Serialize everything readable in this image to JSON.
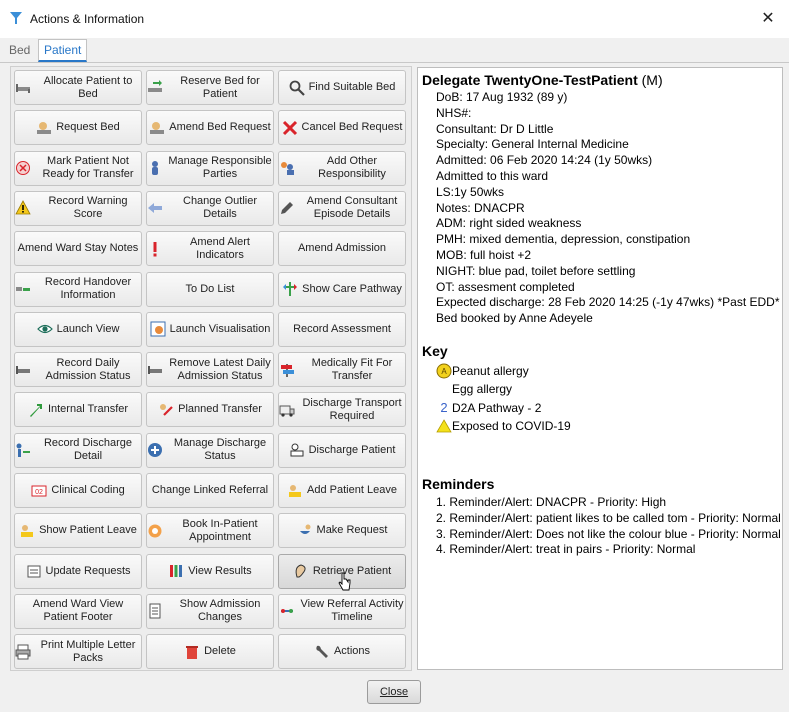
{
  "window": {
    "title": "Actions & Information",
    "close_glyph": "✕"
  },
  "tabs": [
    {
      "label": "Bed"
    },
    {
      "label": "Patient"
    }
  ],
  "buttons": [
    {
      "label": "Allocate Patient to Bed",
      "icon": "bed-icon"
    },
    {
      "label": "Reserve Bed for Patient",
      "icon": "bed-reserve-icon"
    },
    {
      "label": "Find Suitable Bed",
      "icon": "magnifier-icon"
    },
    {
      "label": "Request Bed",
      "icon": "request-bed-icon"
    },
    {
      "label": "Amend Bed Request",
      "icon": "amend-bed-icon"
    },
    {
      "label": "Cancel Bed Request",
      "icon": "red-x-icon"
    },
    {
      "label": "Mark Patient Not Ready for Transfer",
      "icon": "not-ready-icon"
    },
    {
      "label": "Manage Responsible Parties",
      "icon": "person-icon"
    },
    {
      "label": "Add Other Responsibility",
      "icon": "people-add-icon"
    },
    {
      "label": "Record Warning Score",
      "icon": "warning-icon"
    },
    {
      "label": "Change Outlier Details",
      "icon": "left-arrow-icon"
    },
    {
      "label": "Amend Consultant Episode Details",
      "icon": "pencil-icon"
    },
    {
      "label": "Amend Ward Stay Notes",
      "icon": ""
    },
    {
      "label": "Amend Alert Indicators",
      "icon": "exclamation-icon"
    },
    {
      "label": "Amend Admission",
      "icon": ""
    },
    {
      "label": "Record Handover Information",
      "icon": "handover-icon"
    },
    {
      "label": "To Do List",
      "icon": ""
    },
    {
      "label": "Show Care Pathway",
      "icon": "pathway-icon"
    },
    {
      "label": "Launch View",
      "icon": "eye-icon"
    },
    {
      "label": "Launch Visualisation",
      "icon": "visualisation-icon"
    },
    {
      "label": "Record Assessment",
      "icon": ""
    },
    {
      "label": "Record Daily Admission Status",
      "icon": "bed-status-icon"
    },
    {
      "label": "Remove Latest Daily Admission Status",
      "icon": "bed-status-remove-icon"
    },
    {
      "label": "Medically Fit For Transfer",
      "icon": "signpost-icon"
    },
    {
      "label": "Internal Transfer",
      "icon": "green-arrow-icon"
    },
    {
      "label": "Planned Transfer",
      "icon": "planned-transfer-icon"
    },
    {
      "label": "Discharge Transport Required",
      "icon": "ambulance-icon"
    },
    {
      "label": "Record Discharge Detail",
      "icon": "discharge-detail-icon"
    },
    {
      "label": "Manage Discharge Status",
      "icon": "discharge-status-icon"
    },
    {
      "label": "Discharge Patient",
      "icon": "discharge-patient-icon"
    },
    {
      "label": "Clinical Coding",
      "icon": "coding-icon"
    },
    {
      "label": "Change Linked Referral",
      "icon": ""
    },
    {
      "label": "Add Patient Leave",
      "icon": "leave-add-icon"
    },
    {
      "label": "Show Patient Leave",
      "icon": "leave-icon"
    },
    {
      "label": "Book In-Patient Appointment",
      "icon": "appointment-icon"
    },
    {
      "label": "Make Request",
      "icon": "request-icon"
    },
    {
      "label": "Update Requests",
      "icon": "update-requests-icon"
    },
    {
      "label": "View Results",
      "icon": "results-icon"
    },
    {
      "label": "Retrieve Patient",
      "icon": "retrieve-icon"
    },
    {
      "label": "Amend Ward View Patient Footer",
      "icon": ""
    },
    {
      "label": "Show Admission Changes",
      "icon": "document-icon"
    },
    {
      "label": "View Referral Activity Timeline",
      "icon": "timeline-icon"
    },
    {
      "label": "Print Multiple Letter Packs",
      "icon": "print-icon"
    },
    {
      "label": "Delete",
      "icon": "trash-icon"
    },
    {
      "label": "Actions",
      "icon": "wrench-icon"
    }
  ],
  "patient": {
    "name": "Delegate TwentyOne-TestPatient",
    "sex": "(M)",
    "details": [
      "DoB: 17 Aug 1932 (89 y)",
      "NHS#:",
      "Consultant: Dr D Little",
      "Specialty: General Internal Medicine",
      "Admitted: 06 Feb 2020 14:24 (1y 50wks)",
      "Admitted to this ward",
      "LS:1y 50wks",
      "Notes: DNACPR",
      "ADM: right sided weakness",
      "PMH: mixed dementia, depression, constipation",
      "MOB: full hoist +2",
      "NIGHT: blue pad, toilet before settling",
      "OT: assesment completed",
      "Expected discharge: 28 Feb 2020 14:25 (-1y 47wks) *Past EDD*",
      "Bed booked by Anne Adeyele"
    ]
  },
  "key": {
    "title": "Key",
    "items": [
      {
        "icon": "peanut-badge-icon",
        "glyph": "A",
        "label": "Peanut allergy"
      },
      {
        "icon": "",
        "glyph": "",
        "label": "Egg allergy"
      },
      {
        "icon": "d2a-pathway-icon",
        "glyph": "2",
        "label": "D2A Pathway - 2"
      },
      {
        "icon": "covid-triangle-icon",
        "glyph": "",
        "label": "Exposed to COVID-19"
      }
    ]
  },
  "reminders": {
    "title": "Reminders",
    "items": [
      "1. Reminder/Alert: DNACPR - Priority: High",
      "2. Reminder/Alert: patient likes to be called tom - Priority: Normal",
      "3. Reminder/Alert: Does not like the colour blue - Priority: Normal",
      "4. Reminder/Alert: treat in pairs - Priority: Normal"
    ]
  },
  "footer": {
    "close_label": "Close"
  },
  "colors": {
    "accent": "#2877c8",
    "button_face": "#f2f2f2",
    "panel_bg": "#ededed"
  }
}
